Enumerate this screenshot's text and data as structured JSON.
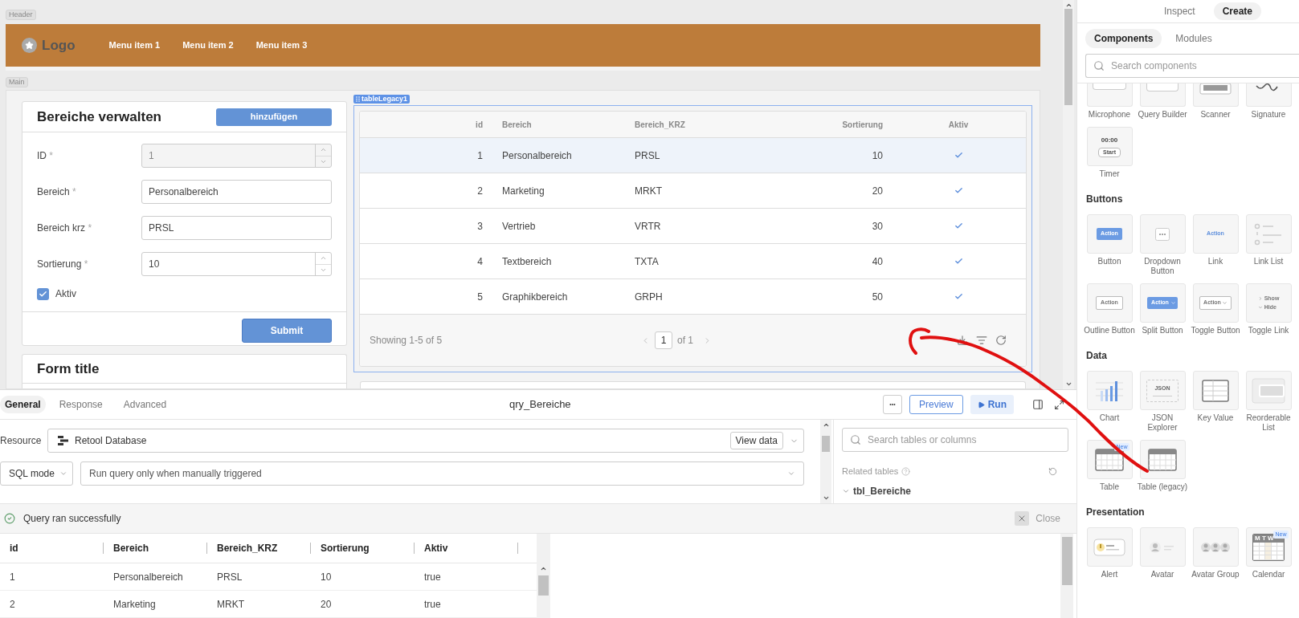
{
  "canvas": {
    "header_label": "Header",
    "logo": "Logo",
    "menu": [
      "Menu item 1",
      "Menu item 2",
      "Menu item 3"
    ],
    "main_label": "Main"
  },
  "form": {
    "title": "Bereiche verwalten",
    "add_button": "hinzufügen",
    "fields": [
      {
        "label": "ID",
        "mark": "*",
        "value": "1",
        "kind": "number",
        "disabled": true
      },
      {
        "label": "Bereich",
        "mark": "*",
        "value": "Personalbereich",
        "kind": "text",
        "disabled": false
      },
      {
        "label": "Bereich krz",
        "mark": "*",
        "value": "PRSL",
        "kind": "text",
        "disabled": false
      },
      {
        "label": "Sortierung",
        "mark": "*",
        "value": "10",
        "kind": "number",
        "disabled": false
      }
    ],
    "checkbox": {
      "label": "Aktiv",
      "checked": true
    },
    "submit": "Submit"
  },
  "form2": {
    "title": "Form title"
  },
  "table": {
    "name": "tableLegacy1",
    "columns": [
      "id",
      "Bereich",
      "Bereich_KRZ",
      "Sortierung",
      "Aktiv"
    ],
    "rows": [
      {
        "id": "1",
        "bereich": "Personalbereich",
        "krz": "PRSL",
        "sortierung": "10",
        "aktiv": true,
        "selected": true
      },
      {
        "id": "2",
        "bereich": "Marketing",
        "krz": "MRKT",
        "sortierung": "20",
        "aktiv": true,
        "selected": false
      },
      {
        "id": "3",
        "bereich": "Vertrieb",
        "krz": "VRTR",
        "sortierung": "30",
        "aktiv": true,
        "selected": false
      },
      {
        "id": "4",
        "bereich": "Textbereich",
        "krz": "TXTA",
        "sortierung": "40",
        "aktiv": true,
        "selected": false
      },
      {
        "id": "5",
        "bereich": "Graphikbereich",
        "krz": "GRPH",
        "sortierung": "50",
        "aktiv": true,
        "selected": false
      }
    ],
    "showing": "Showing 1-5 of 5",
    "page": "1",
    "page_of": "of 1"
  },
  "query": {
    "tabs": [
      {
        "label": "General",
        "selected": true
      },
      {
        "label": "Response",
        "selected": false
      },
      {
        "label": "Advanced",
        "selected": false
      }
    ],
    "title": "qry_Bereiche",
    "more": "•••",
    "preview": "Preview",
    "run": "Run",
    "resource_label": "Resource",
    "resource": "Retool Database",
    "view_data": "View data",
    "mode": "SQL mode",
    "trigger": "Run query only when manually triggered",
    "search_placeholder": "Search tables or columns",
    "related": "Related tables",
    "related_table": "tbl_Bereiche",
    "status": "Query ran successfully",
    "close": "Close",
    "result_columns": [
      "id",
      "Bereich",
      "Bereich_KRZ",
      "Sortierung",
      "Aktiv"
    ],
    "result_rows": [
      [
        "1",
        "Personalbereich",
        "PRSL",
        "10",
        "true"
      ],
      [
        "2",
        "Marketing",
        "MRKT",
        "20",
        "true"
      ]
    ]
  },
  "panel": {
    "tabs": [
      {
        "label": "Inspect",
        "selected": false
      },
      {
        "label": "Create",
        "selected": true
      }
    ],
    "subtabs": [
      {
        "label": "Components",
        "selected": true
      },
      {
        "label": "Modules",
        "selected": false
      }
    ],
    "search_placeholder": "Search components",
    "sections": [
      {
        "tiles": [
          {
            "label": "Microphone",
            "kind": "microphone"
          },
          {
            "label": "Query Builder",
            "kind": "querybuilder"
          },
          {
            "label": "Scanner",
            "kind": "scanner"
          },
          {
            "label": "Signature",
            "kind": "signature"
          },
          {
            "label": "Timer",
            "kind": "timer",
            "texts": [
              "00:00",
              "Start"
            ]
          }
        ]
      },
      {
        "title": "Buttons",
        "tiles": [
          {
            "label": "Button",
            "kind": "solid",
            "texts": [
              "Action"
            ]
          },
          {
            "label": "Dropdown Button",
            "kind": "dots"
          },
          {
            "label": "Link",
            "kind": "link",
            "texts": [
              "Action"
            ]
          },
          {
            "label": "Link List",
            "kind": "linklist"
          },
          {
            "label": "Outline Button",
            "kind": "outline",
            "texts": [
              "Action"
            ]
          },
          {
            "label": "Split Button",
            "kind": "split",
            "texts": [
              "Action"
            ]
          },
          {
            "label": "Toggle Button",
            "kind": "toggle",
            "texts": [
              "Action"
            ]
          },
          {
            "label": "Toggle Link",
            "kind": "showhide",
            "texts": [
              "Show",
              "Hide"
            ]
          }
        ]
      },
      {
        "title": "Data",
        "tiles": [
          {
            "label": "Chart",
            "kind": "chart"
          },
          {
            "label": "JSON Explorer",
            "kind": "json",
            "texts": [
              "JSON"
            ]
          },
          {
            "label": "Key Value",
            "kind": "keyvalue"
          },
          {
            "label": "Reorderable List",
            "kind": "reorder"
          },
          {
            "label": "Table",
            "kind": "table",
            "badge": "New"
          },
          {
            "label": "Table (legacy)",
            "kind": "table"
          }
        ]
      },
      {
        "title": "Presentation",
        "tiles": [
          {
            "label": "Alert",
            "kind": "alert"
          },
          {
            "label": "Avatar",
            "kind": "avatar"
          },
          {
            "label": "Avatar Group",
            "kind": "avatargroup"
          },
          {
            "label": "Calendar",
            "kind": "calendar",
            "texts": [
              "M T W"
            ],
            "badge": "New"
          }
        ]
      }
    ]
  }
}
